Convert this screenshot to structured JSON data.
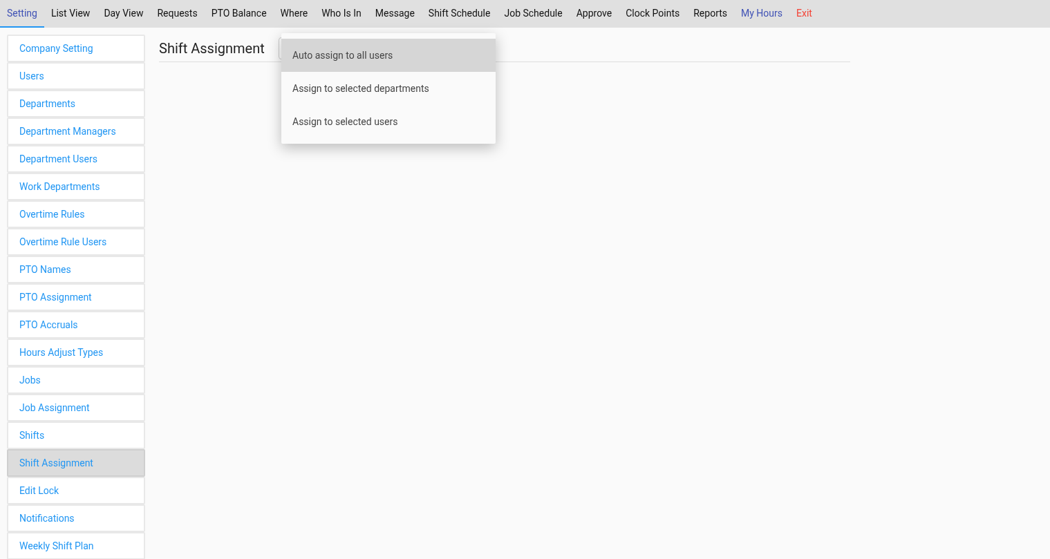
{
  "nav": [
    {
      "label": "Setting",
      "selected": true,
      "kind": "normal"
    },
    {
      "label": "List View",
      "selected": false,
      "kind": "normal"
    },
    {
      "label": "Day View",
      "selected": false,
      "kind": "normal"
    },
    {
      "label": "Requests",
      "selected": false,
      "kind": "normal"
    },
    {
      "label": "PTO Balance",
      "selected": false,
      "kind": "normal"
    },
    {
      "label": "Where",
      "selected": false,
      "kind": "normal"
    },
    {
      "label": "Who Is In",
      "selected": false,
      "kind": "normal"
    },
    {
      "label": "Message",
      "selected": false,
      "kind": "normal"
    },
    {
      "label": "Shift Schedule",
      "selected": false,
      "kind": "normal"
    },
    {
      "label": "Job Schedule",
      "selected": false,
      "kind": "normal"
    },
    {
      "label": "Approve",
      "selected": false,
      "kind": "normal"
    },
    {
      "label": "Clock Points",
      "selected": false,
      "kind": "normal"
    },
    {
      "label": "Reports",
      "selected": false,
      "kind": "normal"
    },
    {
      "label": "My Hours",
      "selected": false,
      "kind": "user"
    },
    {
      "label": "Exit",
      "selected": false,
      "kind": "exit"
    }
  ],
  "sidebar": {
    "items": [
      {
        "label": "Company Setting",
        "selected": false
      },
      {
        "label": "Users",
        "selected": false
      },
      {
        "label": "Departments",
        "selected": false
      },
      {
        "label": "Department Managers",
        "selected": false
      },
      {
        "label": "Department Users",
        "selected": false
      },
      {
        "label": "Work Departments",
        "selected": false
      },
      {
        "label": "Overtime Rules",
        "selected": false
      },
      {
        "label": "Overtime Rule Users",
        "selected": false
      },
      {
        "label": "PTO Names",
        "selected": false
      },
      {
        "label": "PTO Assignment",
        "selected": false
      },
      {
        "label": "PTO Accruals",
        "selected": false
      },
      {
        "label": "Hours Adjust Types",
        "selected": false
      },
      {
        "label": "Jobs",
        "selected": false
      },
      {
        "label": "Job Assignment",
        "selected": false
      },
      {
        "label": "Shifts",
        "selected": false
      },
      {
        "label": "Shift Assignment",
        "selected": true
      },
      {
        "label": "Edit Lock",
        "selected": false
      },
      {
        "label": "Notifications",
        "selected": false
      },
      {
        "label": "Weekly Shift Plan",
        "selected": false
      }
    ]
  },
  "main": {
    "title": "Shift Assignment",
    "dropdown": {
      "options": [
        {
          "label": "Auto assign to all users",
          "selected": true
        },
        {
          "label": "Assign to selected departments",
          "selected": false
        },
        {
          "label": "Assign to selected users",
          "selected": false
        }
      ]
    }
  }
}
